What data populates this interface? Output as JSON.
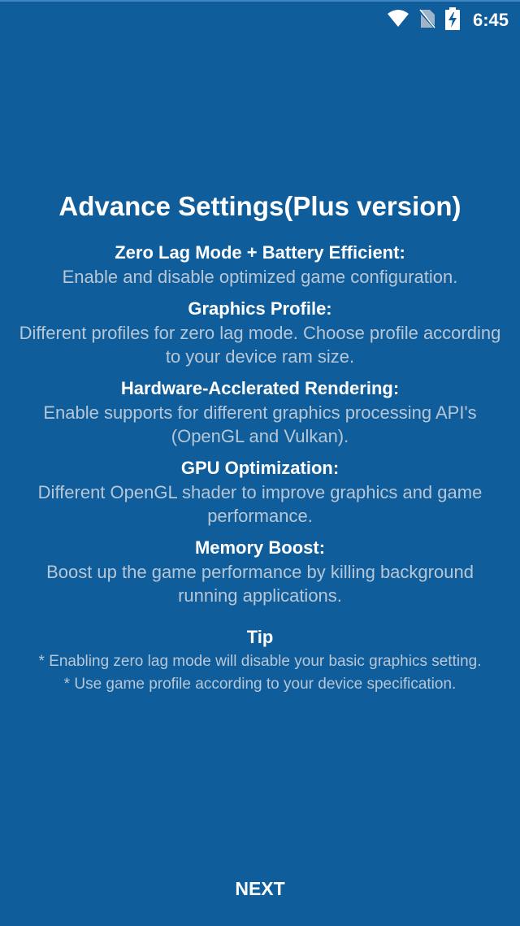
{
  "status_bar": {
    "time": "6:45",
    "icons": [
      "wifi-icon",
      "no-sim-icon",
      "battery-charging-icon"
    ]
  },
  "title": "Advance Settings(Plus version)",
  "features": [
    {
      "title": "Zero Lag Mode + Battery Efficient:",
      "description": "Enable and disable optimized game configuration."
    },
    {
      "title": "Graphics Profile:",
      "description": "Different profiles for zero lag mode. Choose profile according to your device ram size."
    },
    {
      "title": "Hardware-Acclerated Rendering:",
      "description": "Enable supports for different graphics processing API's (OpenGL and Vulkan)."
    },
    {
      "title": "GPU Optimization:",
      "description": "Different OpenGL shader to improve graphics and game performance."
    },
    {
      "title": "Memory Boost:",
      "description": "Boost up the game performance by killing background running applications."
    }
  ],
  "tip": {
    "title": "Tip",
    "lines": [
      "* Enabling zero lag mode will disable your basic graphics setting.",
      "* Use game profile according to your device specification."
    ]
  },
  "next_label": "NEXT",
  "colors": {
    "background": "#0f5d9b",
    "heading": "#ffffff",
    "body_text": "#b7c7d6"
  }
}
